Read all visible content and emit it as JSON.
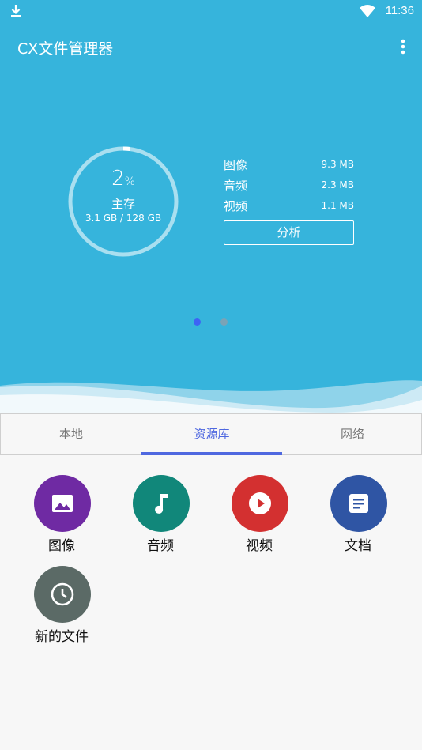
{
  "status_bar": {
    "time": "11:36"
  },
  "app_bar": {
    "title": "CX文件管理器"
  },
  "storage": {
    "percent": "2",
    "percent_unit": "%",
    "usage_fraction": 0.02,
    "label": "主存",
    "size_text": "3.1 GB / 128 GB"
  },
  "stats": [
    {
      "name": "图像",
      "value": "9.3 MB"
    },
    {
      "name": "音频",
      "value": "2.3 MB"
    },
    {
      "name": "视频",
      "value": "1.1 MB"
    }
  ],
  "analyze_label": "分析",
  "pager": {
    "count": 2,
    "active": 0
  },
  "tabs": [
    {
      "label": "本地"
    },
    {
      "label": "资源库"
    },
    {
      "label": "网络"
    }
  ],
  "active_tab": 1,
  "library": [
    {
      "label": "图像",
      "icon": "image-icon",
      "color": "#6f2aa3"
    },
    {
      "label": "音频",
      "icon": "music-note-icon",
      "color": "#11877a"
    },
    {
      "label": "视频",
      "icon": "play-circle-icon",
      "color": "#d33030"
    },
    {
      "label": "文档",
      "icon": "document-icon",
      "color": "#2f55a4"
    },
    {
      "label": "新的文件",
      "icon": "clock-icon",
      "color": "#5b6a66"
    }
  ],
  "colors": {
    "primary": "#36b4dc",
    "accent": "#4f68e0"
  }
}
